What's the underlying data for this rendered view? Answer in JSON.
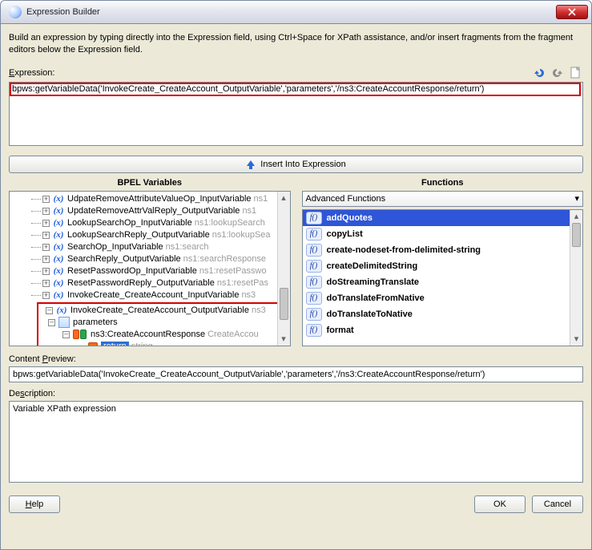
{
  "window": {
    "title": "Expression Builder"
  },
  "intro": "Build an expression by typing directly into the Expression field, using Ctrl+Space for XPath assistance, and/or insert fragments from the fragment editors below the Expression field.",
  "labels": {
    "expression_prefix": "E",
    "expression_rest": "xpression:",
    "content_preview_prefix": "Content ",
    "content_preview_u": "P",
    "content_preview_rest": "review:",
    "description_prefix": "De",
    "description_u": "s",
    "description_rest": "cription:",
    "bpel_header": "BPEL Variables",
    "functions_header": "Functions"
  },
  "expression_value": "bpws:getVariableData('InvokeCreate_CreateAccount_OutputVariable','parameters','/ns3:CreateAccountResponse/return')",
  "insert_button": "Insert Into Expression",
  "tree": [
    {
      "name": "UdpateRemoveAttributeValueOp_InputVariable",
      "type": "ns1"
    },
    {
      "name": "UpdateRemoveAttrValReply_OutputVariable",
      "type": "ns1"
    },
    {
      "name": "LookupSearchOp_InputVariable",
      "type": "ns1:lookupSearch"
    },
    {
      "name": "LookupSearchReply_OutputVariable",
      "type": "ns1:lookupSea"
    },
    {
      "name": "SearchOp_InputVariable",
      "type": "ns1:search"
    },
    {
      "name": "SearchReply_OutputVariable",
      "type": "ns1:searchResponse"
    },
    {
      "name": "ResetPasswordOp_InputVariable",
      "type": "ns1:resetPasswo"
    },
    {
      "name": "ResetPasswordReply_OutputVariable",
      "type": "ns1:resetPas"
    },
    {
      "name": "InvokeCreate_CreateAccount_InputVariable",
      "type": "ns3"
    }
  ],
  "tree_selected": {
    "var": "InvokeCreate_CreateAccount_OutputVariable",
    "var_type": "ns3",
    "p1": "parameters",
    "p2": "ns3:CreateAccountResponse",
    "p2_type": "CreateAccou",
    "p3": "return",
    "p3_type": "string"
  },
  "functions": {
    "category": "Advanced Functions",
    "items": [
      "addQuotes",
      "copyList",
      "create-nodeset-from-delimited-string",
      "createDelimitedString",
      "doStreamingTranslate",
      "doTranslateFromNative",
      "doTranslateToNative",
      "format"
    ]
  },
  "content_preview": "bpws:getVariableData('InvokeCreate_CreateAccount_OutputVariable','parameters','/ns3:CreateAccountResponse/return')",
  "description": "Variable XPath expression",
  "buttons": {
    "help": "Help",
    "ok": "OK",
    "cancel": "Cancel"
  }
}
